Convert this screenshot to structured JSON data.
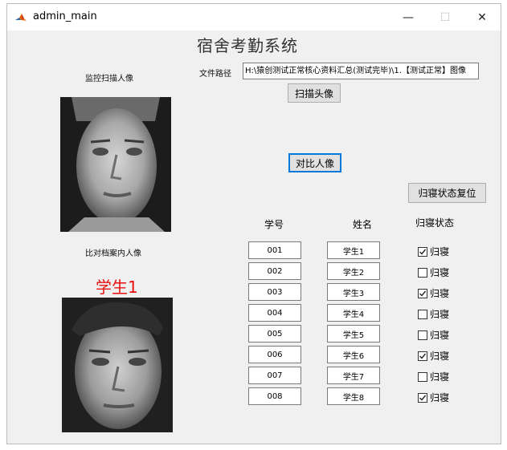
{
  "window": {
    "title": "admin_main",
    "minimize_glyph": "—",
    "maximize_glyph": "☐",
    "close_glyph": "✕",
    "icon": "matlab-icon"
  },
  "system_title": "宿舍考勤系统",
  "monitor": {
    "label": "监控扫描人像"
  },
  "archive": {
    "label": "比对档案内人像",
    "matched_name": "学生1"
  },
  "file_path": {
    "label": "文件路径",
    "value": "H:\\猿创测试正常核心资料汇总(测试完毕)\\1.【测试正常】图像"
  },
  "buttons": {
    "scan": "扫描头像",
    "compare": "对比人像",
    "reset": "归寝状态复位"
  },
  "columns": {
    "id": "学号",
    "name": "姓名",
    "status": "归寝状态"
  },
  "students": [
    {
      "id": "001",
      "name": "学生1",
      "status_label": "归寝",
      "checked": true
    },
    {
      "id": "002",
      "name": "学生2",
      "status_label": "归寝",
      "checked": false
    },
    {
      "id": "003",
      "name": "学生3",
      "status_label": "归寝",
      "checked": true
    },
    {
      "id": "004",
      "name": "学生4",
      "status_label": "归寝",
      "checked": false
    },
    {
      "id": "005",
      "name": "学生5",
      "status_label": "归寝",
      "checked": false
    },
    {
      "id": "006",
      "name": "学生6",
      "status_label": "归寝",
      "checked": true
    },
    {
      "id": "007",
      "name": "学生7",
      "status_label": "归寝",
      "checked": false
    },
    {
      "id": "008",
      "name": "学生8",
      "status_label": "归寝",
      "checked": true
    }
  ],
  "colors": {
    "accent": "#0078d7",
    "matched_name": "#e81010"
  }
}
